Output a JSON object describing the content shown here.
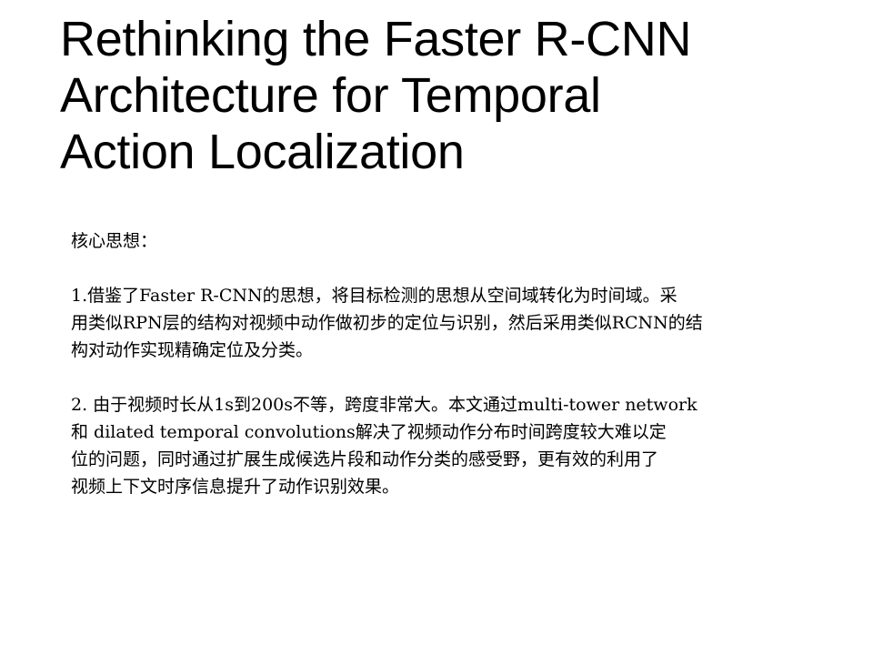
{
  "slide": {
    "title_lines": [
      "Rethinking the Faster R-CNN",
      "Architecture for Temporal",
      "Action Localization"
    ],
    "heading": "核心思想：",
    "point1_lines": [
      "1.借鉴了Faster R-CNN的思想，将目标检测的思想从空间域转化为时间域。采",
      "用类似RPN层的结构对视频中动作做初步的定位与识别，然后采用类似RCNN的结",
      "构对动作实现精确定位及分类。"
    ],
    "point2_lines": [
      "2. 由于视频时长从1s到200s不等，跨度非常大。本文通过multi-tower network",
      "和 dilated temporal convolutions解决了视频动作分布时间跨度较大难以定",
      "位的问题，同时通过扩展生成候选片段和动作分类的感受野，更有效的利用了",
      "视频上下文时序信息提升了动作识别效果。"
    ]
  }
}
